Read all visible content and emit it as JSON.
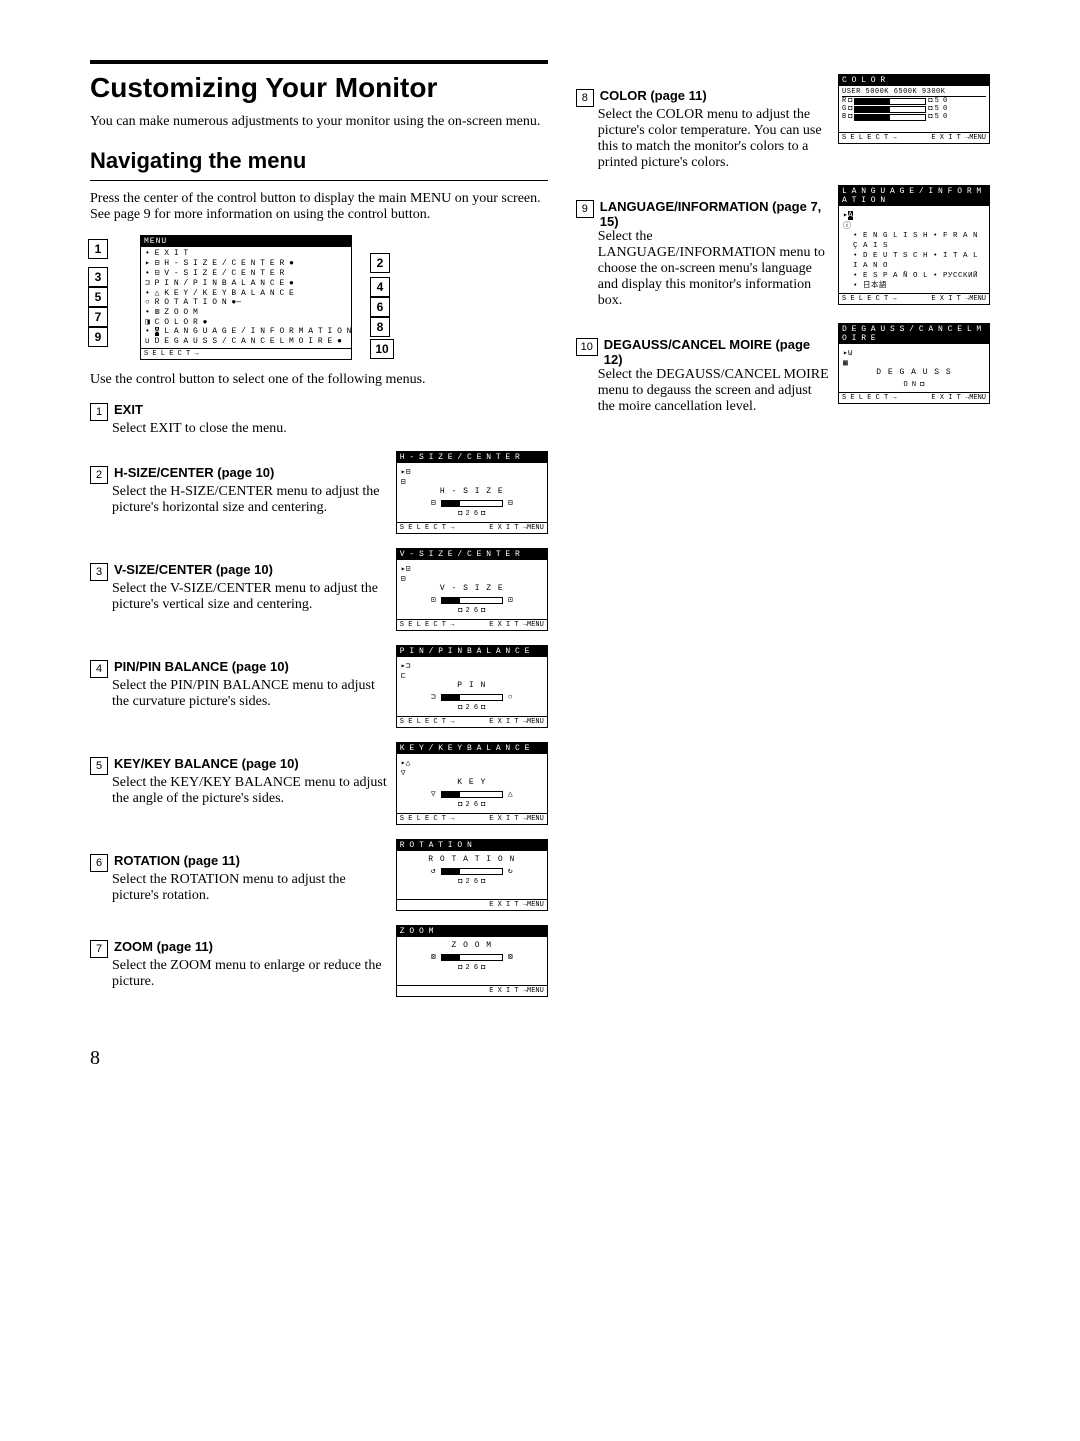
{
  "page_number": "8",
  "h1": "Customizing Your Monitor",
  "intro": "You can make numerous adjustments to your monitor using the on-screen menu.",
  "h2": "Navigating the menu",
  "nav_intro": "Press the center of the control button to display the main MENU on your screen. See page 9 for more information on using the control button.",
  "main_menu": {
    "title": "MENU",
    "items": [
      "E X I T",
      "H - S I Z E / C E N T E R",
      "V - S I Z E / C E N T E R",
      "P I N / P I N   B A L A N C E",
      "K E Y / K E Y   B A L A N C E",
      "R O T A T I O N",
      "Z O O M",
      "C O L O R",
      "L A N G U A G E / I N F O R M A T I O N",
      "D E G A U S S / C A N C E L   M O I R E"
    ],
    "footer": "S E L E C T →"
  },
  "after_menu": "Use the control button to select one of the following menus.",
  "items": [
    {
      "num": "1",
      "title": "EXIT",
      "body": "Select EXIT to close the menu."
    },
    {
      "num": "2",
      "title": "H-SIZE/CENTER (page 10)",
      "body": "Select the H-SIZE/CENTER menu to adjust the picture's horizontal size and centering.",
      "osd": {
        "title": "H - S I Z E / C E N T E R",
        "label": "H - S I Z E",
        "val": "2 6",
        "foot_l": "S E L E C T →",
        "foot_r": "E X I T →MENU"
      }
    },
    {
      "num": "3",
      "title": "V-SIZE/CENTER (page 10)",
      "body": "Select the V-SIZE/CENTER menu to adjust the picture's vertical size and centering.",
      "osd": {
        "title": "V - S I Z E / C E N T E R",
        "label": "V - S I Z E",
        "val": "2 6",
        "foot_l": "S E L E C T →",
        "foot_r": "E X I T →MENU"
      }
    },
    {
      "num": "4",
      "title": "PIN/PIN BALANCE (page 10)",
      "body": "Select the PIN/PIN BALANCE menu to adjust the curvature picture's sides.",
      "osd": {
        "title": "P I N / P I N   B A L A N C E",
        "label": "P I N",
        "val": "2 6",
        "foot_l": "S E L E C T →",
        "foot_r": "E X I T →MENU"
      }
    },
    {
      "num": "5",
      "title": "KEY/KEY BALANCE (page 10)",
      "body": "Select the KEY/KEY BALANCE menu to adjust the angle of the picture's sides.",
      "osd": {
        "title": "K E Y / K E Y   B A L A N C E",
        "label": "K E Y",
        "val": "2 6",
        "foot_l": "S E L E C T →",
        "foot_r": "E X I T →MENU"
      }
    },
    {
      "num": "6",
      "title": "ROTATION (page 11)",
      "body": "Select the ROTATION menu to adjust the picture's rotation.",
      "osd": {
        "title": "R O T A T I O N",
        "label": "R O T A T I O N",
        "val": "2 6",
        "foot_l": "",
        "foot_r": "E X I T →MENU"
      }
    },
    {
      "num": "7",
      "title": "ZOOM (page 11)",
      "body": "Select the ZOOM menu to enlarge or reduce the picture.",
      "osd": {
        "title": "Z O O M",
        "label": "Z O O M",
        "val": "2 6",
        "foot_l": "",
        "foot_r": "E X I T →MENU"
      }
    }
  ],
  "items_r": [
    {
      "num": "8",
      "title": "COLOR (page 11)",
      "body": "Select the COLOR menu to adjust the picture's color temperature. You can use this to match the monitor's colors to a printed picture's colors.",
      "osd": {
        "title": "C O L O R",
        "tabs": "USER  5000K  6500K  9300K",
        "rows": [
          "R",
          "G",
          "B"
        ],
        "rv": "5 0",
        "foot_l": "S E L E C T →",
        "foot_r": "E X I T →MENU"
      }
    },
    {
      "num": "9",
      "title": "LANGUAGE/INFORMATION (page 7, 15)",
      "body": "Select the LANGUAGE/INFORMATION menu to choose the on-screen menu's language and display this monitor's information box.",
      "osd": {
        "title": "L A N G U A G E / I N F O R M A T I O N",
        "langs": [
          "• E N G L I S H   • F R A N Ç A I S",
          "• D E U T S C H   • I T A L I A N O",
          "• E S P A Ñ O L   • РУССКИЙ",
          "• 日本語"
        ],
        "foot_l": "S E L E C T →",
        "foot_r": "E X I T →MENU"
      }
    },
    {
      "num": "10",
      "title": "DEGAUSS/CANCEL MOIRE (page 12)",
      "body": "Select the DEGAUSS/CANCEL MOIRE menu to degauss the screen and adjust the moire cancellation level.",
      "osd": {
        "title": "D E G A U S S / C A N C E L   M O I R E",
        "label": "D E G A U S S",
        "on": "O N  ◘",
        "foot_l": "S E L E C T →",
        "foot_r": "E X I T →MENU"
      }
    }
  ]
}
